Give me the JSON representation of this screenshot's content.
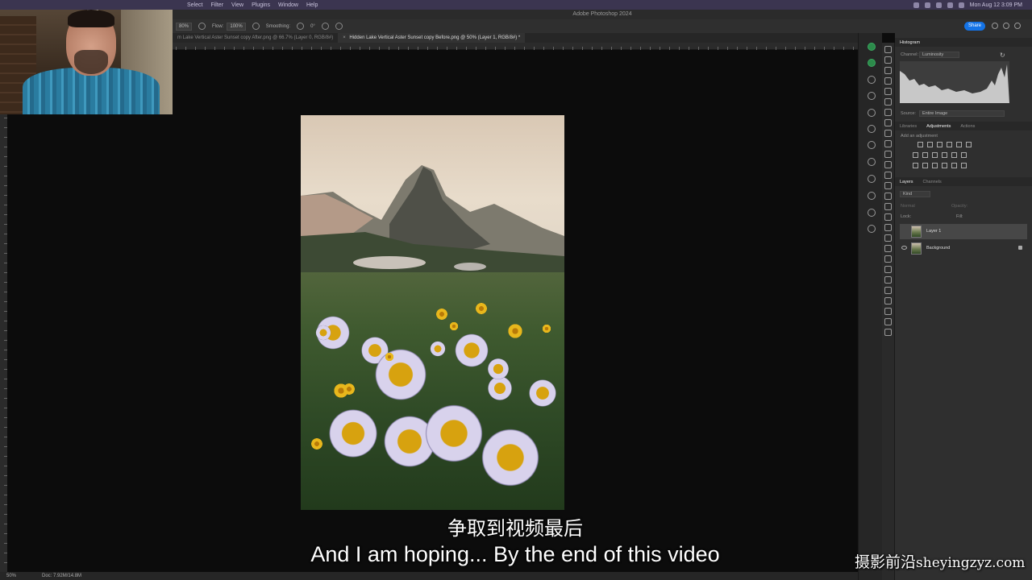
{
  "app": {
    "title": "Adobe Photoshop 2024",
    "menus": [
      "Select",
      "Filter",
      "View",
      "Plugins",
      "Window",
      "Help"
    ],
    "clock": "Mon Aug 12  3:09 PM"
  },
  "options_bar": {
    "zoom_value": "80%",
    "flow_label": "Flow:",
    "flow_value": "100%",
    "smoothing_label": "Smoothing:",
    "angle_value": "0°",
    "share_label": "Share"
  },
  "tabs": [
    {
      "label": "m Lake Vertical Aster Sunset copy After.png @ 66.7% (Layer 0, RGB/8#)",
      "active": false
    },
    {
      "label": "Hidden Lake Vertical Aster Sunset copy Before.png @ 50% (Layer 1, RGB/8#) *",
      "active": true
    }
  ],
  "status_bar": {
    "zoom": "50%",
    "doc": "Doc: 7.92M/14.8M"
  },
  "panels": {
    "histogram": {
      "title": "Histogram",
      "channel_label": "Channel:",
      "channel_value": "Luminosity",
      "source_label": "Source:",
      "source_value": "Entire Image"
    },
    "adjustments": {
      "tabs": [
        "Libraries",
        "Adjustments",
        "Actions"
      ],
      "active_tab": "Adjustments",
      "hint": "Add an adjustment"
    },
    "layers": {
      "tabs": [
        "Layers",
        "Channels"
      ],
      "kind_label": "Kind",
      "blend_mode": "Normal",
      "opacity_label": "Opacity:",
      "lock_label": "Lock:",
      "fill_label": "Fill:",
      "items": [
        {
          "name": "Layer 1",
          "selected": true
        },
        {
          "name": "Background",
          "selected": false
        }
      ]
    }
  },
  "subtitles": {
    "chinese": "争取到视频最后",
    "english": "And I am hoping... By the end of this video"
  },
  "watermark": {
    "chinese": "摄影前沿",
    "url": "sheyingzyz.com"
  }
}
